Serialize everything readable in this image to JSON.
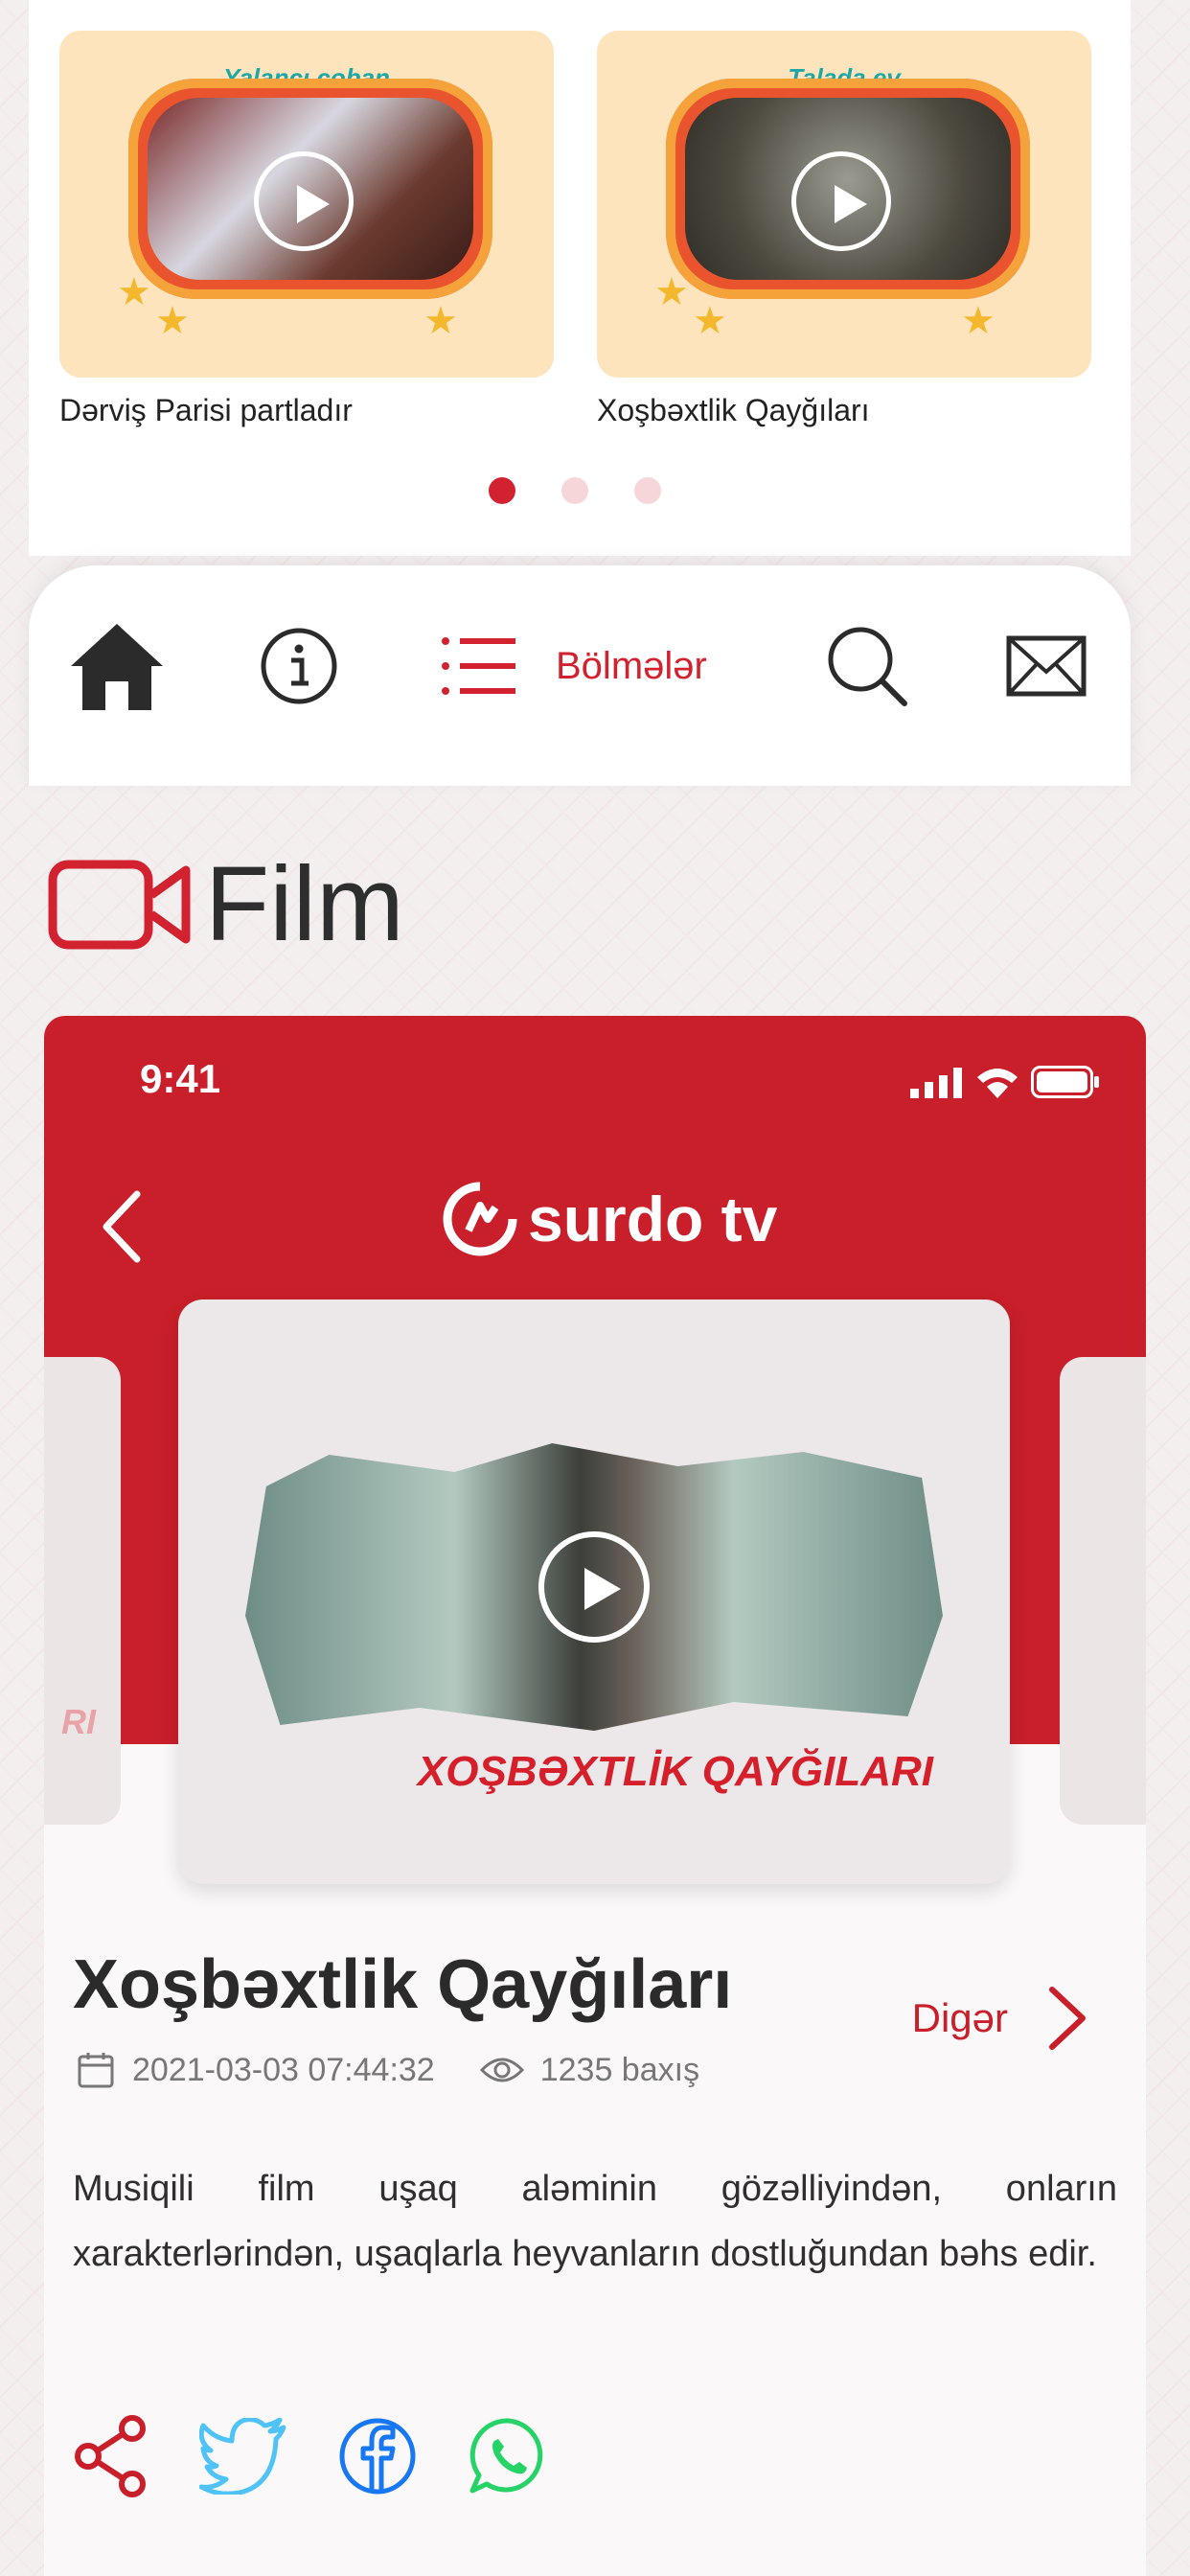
{
  "carousel": {
    "items": [
      {
        "thumb_title": "Yalançı çoban",
        "caption": "Dərviş Parisi partladır"
      },
      {
        "thumb_title": "Talada ev",
        "caption": "Xoşbəxtlik Qayğıları"
      }
    ],
    "active_dot": 0,
    "dot_count": 3
  },
  "nav": {
    "items": [
      {
        "icon": "home-icon"
      },
      {
        "icon": "info-icon"
      },
      {
        "icon": "list-icon",
        "label": "Bölmələr"
      },
      {
        "icon": "search-icon"
      },
      {
        "icon": "mail-icon"
      }
    ]
  },
  "section": {
    "title": "Film",
    "icon": "video-camera-icon"
  },
  "phone": {
    "time": "9:41",
    "brand": "surdo tv",
    "video_banner": "XOŞBƏXTLİK QAYĞILARI",
    "left_peek_text": "RI"
  },
  "movie": {
    "title": "Xoşbəxtlik Qayğıları",
    "more_label": "Digər",
    "date": "2021-03-03 07:44:32",
    "views": "1235 baxış",
    "description": "Musiqili film uşaq aləminin gözəlliyindən, onların xarakterlərindən, uşaqlarla heyvanların dostluğundan bəhs edir."
  },
  "share": [
    "share-icon",
    "twitter-icon",
    "facebook-icon",
    "whatsapp-icon"
  ],
  "colors": {
    "accent": "#c91f2a",
    "twitter": "#4fc3f7",
    "facebook": "#1877f2",
    "whatsapp": "#25d366"
  }
}
